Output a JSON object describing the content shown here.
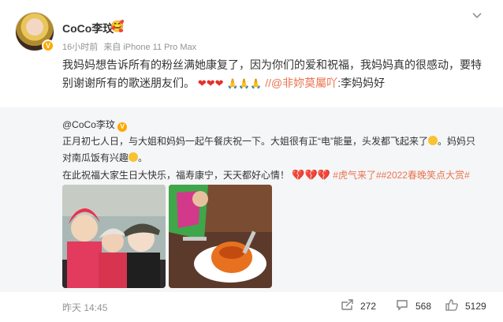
{
  "post": {
    "username": "CoCo李玟",
    "flag_emoji": "🥰",
    "verified_badge": "V",
    "time": "16小时前",
    "source": "来自 iPhone 11 Pro Max",
    "more_icon": "chevron-down-icon",
    "text_line1": "我妈妈想告诉所有的粉丝满她康复了，因为你们的爱和祝福，我妈妈真的很感动，要特",
    "text_line2_prefix": "别谢谢所有的歌迷朋友们。",
    "hearts": "❤❤❤",
    "prays": "🙏🙏🙏",
    "repost_sep": "//",
    "mention": "@非妳莫屬吖",
    "mention_suffix": ":李妈妈好"
  },
  "retweet": {
    "author": "@CoCo李玟",
    "line1": "正月初七人日，与大姐和妈妈一起午餐庆祝一下。大姐很有正“电”能量，头发都飞起来了",
    "line1_end": "。妈妈只",
    "line2": "对南瓜饭有兴趣",
    "line2_end": "。",
    "line3": "在此祝福大家生日大快乐，福寿康宁，天天都好心情！",
    "line3_hearts": "💔💔💔",
    "tags": "#虎气来了##2022春晚笑点大赏#"
  },
  "footer": {
    "time": "昨天 14:45",
    "reposts": "272",
    "comments": "568",
    "likes": "5129"
  },
  "colors": {
    "link": "#eb7350",
    "meta": "#939393",
    "retweet_bg": "#f5f6f7",
    "badge": "#ffa800"
  }
}
